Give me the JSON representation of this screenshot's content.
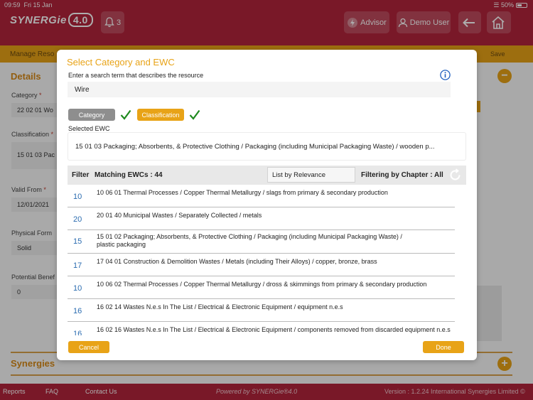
{
  "status": {
    "time": "09:59",
    "date": "Fri 15 Jan",
    "battery": "50%"
  },
  "header": {
    "logo": "SYNERGie",
    "logo_version": "4.0",
    "notification_count": "3",
    "advisor_label": "Advisor",
    "user_label": "Demo User"
  },
  "background": {
    "subbar_title": "Manage Reso",
    "save_label": "Save",
    "details_title": "Details",
    "category_label": "Category",
    "category_value": "22 02 01 Wo",
    "classification_label": "Classification",
    "classification_value": "15 01 03 Pac",
    "valid_from_label": "Valid From",
    "valid_from_value": "12/01/2021",
    "physical_form_label": "Physical Form",
    "physical_form_value": "Solid",
    "potential_benefit_label": "Potential Benef",
    "potential_benefit_value": "0",
    "synergies_title": "Synergies"
  },
  "modal": {
    "title": "Select Category and EWC",
    "instruction": "Enter a search term that describes the resource",
    "search_value": "Wire",
    "tabs": {
      "category": "Category",
      "classification": "Classification"
    },
    "selected_label": "Selected EWC",
    "selected_value": "15 01 03  Packaging; Absorbents, & Protective Clothing / Packaging (including Municipal Packaging Waste) /  wooden p...",
    "filter_label": "Filter",
    "matching_label": "Matching EWCs : 44",
    "sort_value": "List by Relevance",
    "chapter_filter": "Filtering by Chapter : All",
    "rows": [
      {
        "chapter": "10",
        "line1": "10 06 01  Thermal Processes / Copper Thermal Metallurgy /  slags from primary & secondary production",
        "line2": ""
      },
      {
        "chapter": "20",
        "line1": "20 01 40  Municipal Wastes / Separately Collected /  metals",
        "line2": ""
      },
      {
        "chapter": "15",
        "line1": "15 01 02  Packaging; Absorbents, & Protective Clothing / Packaging (including Municipal Packaging Waste) /",
        "line2": " plastic packaging"
      },
      {
        "chapter": "17",
        "line1": "17 04 01  Construction & Demolition Wastes   / Metals (including Their Alloys) /  copper, bronze, brass",
        "line2": ""
      },
      {
        "chapter": "10",
        "line1": "10 06 02  Thermal Processes / Copper Thermal Metallurgy /  dross & skimmings from primary & secondary production",
        "line2": ""
      },
      {
        "chapter": "16",
        "line1": "16 02 14  Wastes N.e.s In The List / Electrical & Electronic Equipment /  equipment n.e.s",
        "line2": ""
      },
      {
        "chapter": "16",
        "line1": "16 02 16  Wastes N.e.s In The List / Electrical & Electronic Equipment /  components removed from discarded equipment n.e.s",
        "line2": ""
      }
    ],
    "cancel_label": "Cancel",
    "done_label": "Done"
  },
  "footer": {
    "reports": "Reports",
    "faq": "FAQ",
    "contact": "Contact Us",
    "powered": "Powered by SYNERGie®4.0",
    "version": "Version : 1.2.24  International Synergies Limited ©"
  },
  "colors": {
    "brand": "#b3243b",
    "accent": "#e8a317",
    "link": "#2b6cb0",
    "check": "#1e8a1e"
  }
}
